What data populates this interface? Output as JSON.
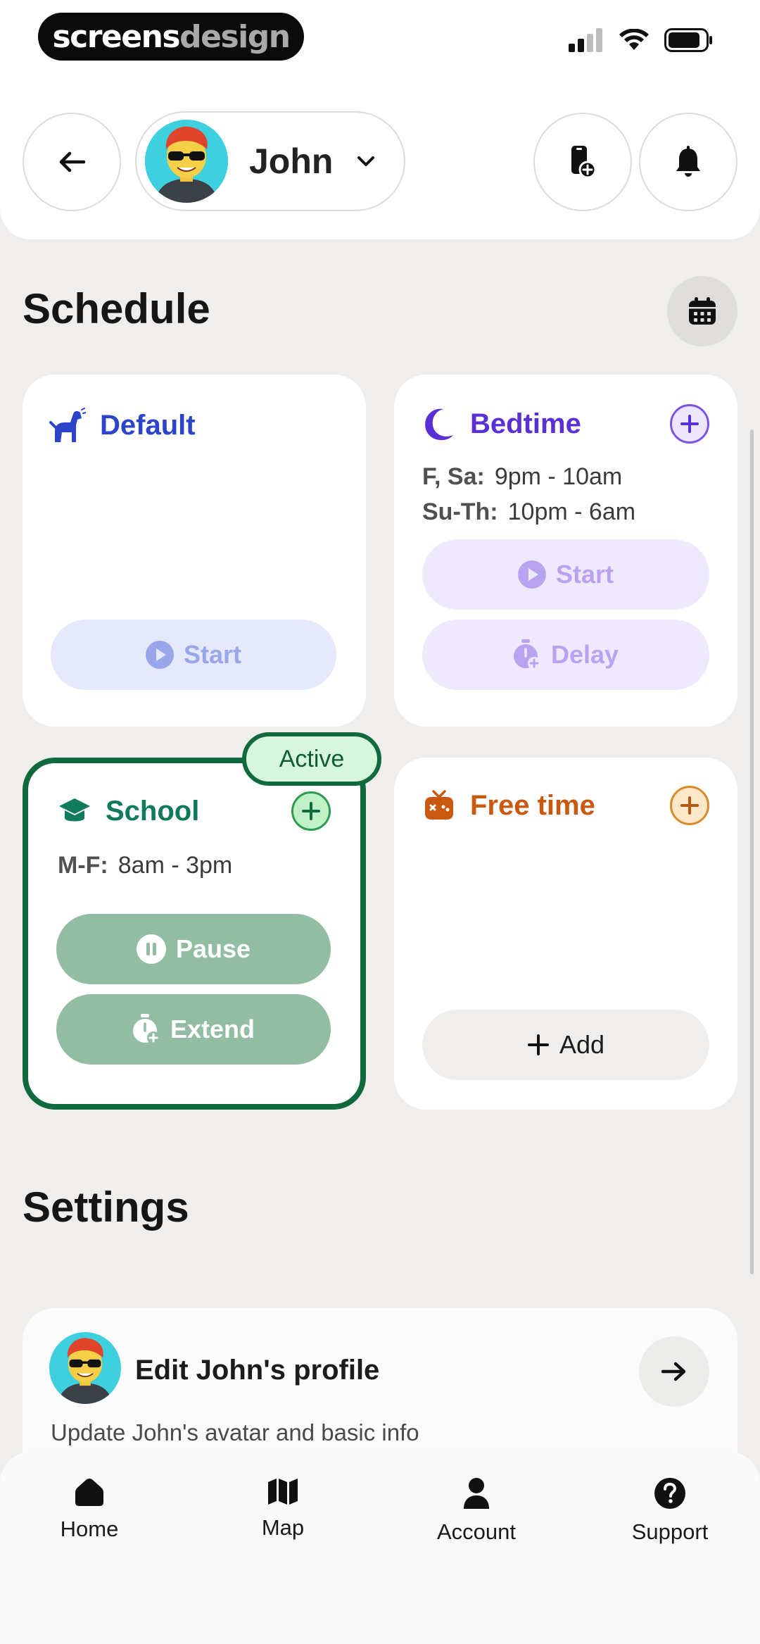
{
  "brand": {
    "part1": "screens",
    "part2": "design"
  },
  "header": {
    "child_name": "John"
  },
  "schedule": {
    "title": "Schedule",
    "cards": [
      {
        "id": "default",
        "title": "Default",
        "color": "#2b44c9",
        "buttons": [
          "Start"
        ]
      },
      {
        "id": "bedtime",
        "title": "Bedtime",
        "color": "#5a2fd6",
        "lines": [
          {
            "days": "F, Sa:",
            "time": "9pm - 10am"
          },
          {
            "days": "Su-Th:",
            "time": "10pm - 6am"
          }
        ],
        "buttons": [
          "Start",
          "Delay"
        ]
      },
      {
        "id": "school",
        "title": "School",
        "color": "#0f7a5c",
        "badge": "Active",
        "lines": [
          {
            "days": "M-F:",
            "time": "8am - 3pm"
          }
        ],
        "buttons": [
          "Pause",
          "Extend"
        ]
      },
      {
        "id": "freetime",
        "title": "Free time",
        "color": "#c9590f",
        "buttons": [
          "Add"
        ]
      }
    ]
  },
  "settings": {
    "title": "Settings",
    "profile_card": {
      "title": "Edit John's profile",
      "subtitle": "Update John's avatar and basic info"
    }
  },
  "tabs": [
    {
      "label": "Home",
      "icon": "home-icon"
    },
    {
      "label": "Map",
      "icon": "map-icon"
    },
    {
      "label": "Account",
      "icon": "account-icon"
    },
    {
      "label": "Support",
      "icon": "support-icon"
    }
  ]
}
